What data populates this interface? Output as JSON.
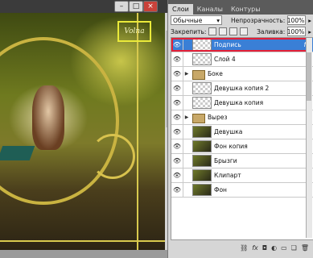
{
  "window_buttons": {
    "min": "–",
    "max": "□",
    "close": "×"
  },
  "canvas": {
    "signature": "Volna"
  },
  "panel": {
    "tabs": [
      "Слои",
      "Каналы",
      "Контуры"
    ],
    "blend_mode": "Обычные",
    "opacity_label": "Непрозрачность:",
    "opacity_value": "100%",
    "lock_label": "Закрепить:",
    "fill_label": "Заливка:",
    "fill_value": "100%",
    "layers": [
      {
        "name": "Подпись",
        "type": "transparent",
        "selected": true,
        "fx": "fx"
      },
      {
        "name": "Слой 4",
        "type": "transparent"
      },
      {
        "name": "Боке",
        "type": "folder"
      },
      {
        "name": "Девушка копия 2",
        "type": "transparent"
      },
      {
        "name": "Девушка копия",
        "type": "transparent"
      },
      {
        "name": "Вырез",
        "type": "folder"
      },
      {
        "name": "Девушка",
        "type": "image"
      },
      {
        "name": "Фон копия",
        "type": "image"
      },
      {
        "name": "Брызги",
        "type": "image"
      },
      {
        "name": "Клипарт",
        "type": "image"
      },
      {
        "name": "Фон",
        "type": "image"
      }
    ],
    "bottom_icons": [
      "link-icon",
      "fx-icon",
      "mask-icon",
      "adjustment-icon",
      "folder-icon",
      "new-layer-icon",
      "trash-icon"
    ]
  }
}
